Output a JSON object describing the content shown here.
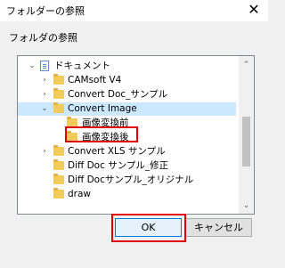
{
  "window": {
    "title": "フォルダーの参照",
    "close_glyph": "✕"
  },
  "dialog": {
    "instruction": "フォルダの参照"
  },
  "tree": {
    "items": [
      {
        "label": "ドキュメント",
        "expander": "⌄",
        "icon": "document-icon"
      },
      {
        "label": "CAMsoft V4",
        "expander": "›",
        "icon": "folder-icon"
      },
      {
        "label": "Convert Doc_サンプル",
        "expander": "›",
        "icon": "folder-icon"
      },
      {
        "label": "Convert Image",
        "expander": "⌄",
        "icon": "folder-icon",
        "selected": true
      },
      {
        "label": "画像変換前",
        "expander": "",
        "icon": "folder-icon"
      },
      {
        "label": "画像変換後",
        "expander": "",
        "icon": "folder-icon"
      },
      {
        "label": "Convert XLS サンプル",
        "expander": "›",
        "icon": "folder-icon"
      },
      {
        "label": "Diff Doc サンプル_修正",
        "expander": "",
        "icon": "folder-icon"
      },
      {
        "label": "Diff Docサンプル_オリジナル",
        "expander": "",
        "icon": "folder-icon"
      },
      {
        "label": "draw",
        "expander": "",
        "icon": "folder-icon"
      }
    ]
  },
  "scrollbar": {
    "up_glyph": "⌃",
    "down_glyph": "⌄"
  },
  "buttons": {
    "ok": "OK",
    "cancel": "キャンセル"
  },
  "colors": {
    "highlight": "#e00000",
    "selection": "#cce8ff",
    "folder": "#f2cc5a"
  }
}
